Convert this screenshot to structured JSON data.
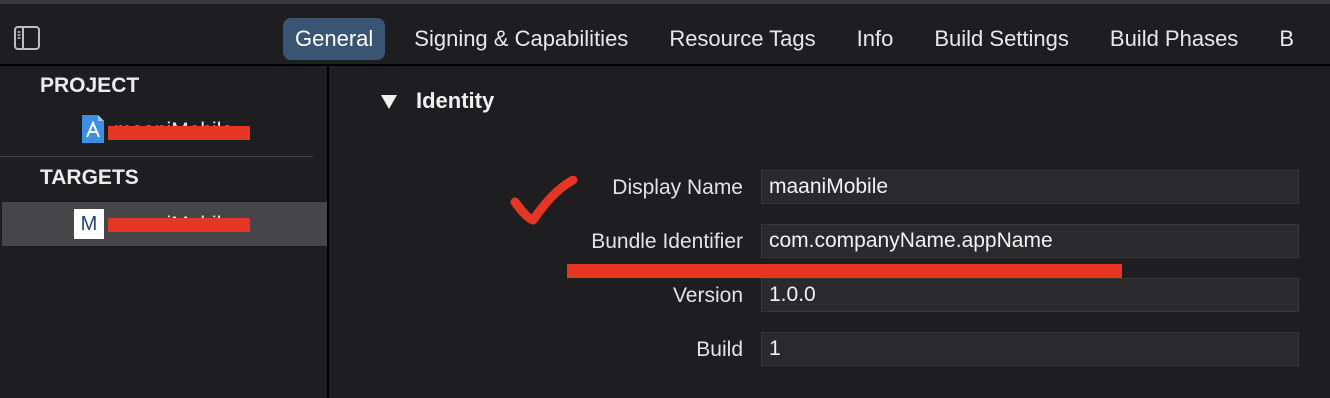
{
  "toolbar": {
    "sidebar_toggle_icon": "sidebar-toggle-icon",
    "tabs": [
      {
        "label": "General",
        "active": true
      },
      {
        "label": "Signing & Capabilities",
        "active": false
      },
      {
        "label": "Resource Tags",
        "active": false
      },
      {
        "label": "Info",
        "active": false
      },
      {
        "label": "Build Settings",
        "active": false
      },
      {
        "label": "Build Phases",
        "active": false
      },
      {
        "label": "B",
        "active": false
      }
    ]
  },
  "sidebar": {
    "project_header": "PROJECT",
    "project_item": {
      "label": "maaniMobile",
      "icon": "xcode-project-icon"
    },
    "targets_header": "TARGETS",
    "target_item": {
      "label": "maaniMobile",
      "icon_letter": "M",
      "selected": true
    }
  },
  "identity": {
    "title": "Identity",
    "fields": [
      {
        "label": "Display Name",
        "value": "maaniMobile"
      },
      {
        "label": "Bundle Identifier",
        "value": "com.companyName.appName"
      },
      {
        "label": "Version",
        "value": "1.0.0"
      },
      {
        "label": "Build",
        "value": "1"
      }
    ]
  },
  "colors": {
    "background": "#1e1e20",
    "active_tab": "#3a5574",
    "selection": "#464649",
    "annotation_red": "#e53524"
  }
}
